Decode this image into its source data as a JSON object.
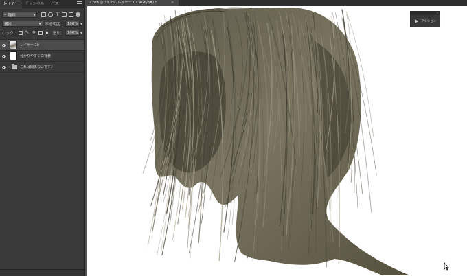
{
  "panel": {
    "tabs": [
      {
        "label": "レイヤー"
      },
      {
        "label": "チャンネル"
      },
      {
        "label": "パス"
      }
    ],
    "filter": {
      "value": "種類"
    },
    "blend_mode": {
      "value": "通常"
    },
    "opacity": {
      "label": "不透明度：",
      "value": "100%"
    },
    "lock": {
      "label": "ロック："
    },
    "fill": {
      "label": "塗り：",
      "value": "100%"
    },
    "layers": [
      {
        "name": "レイヤー 10",
        "selected": true
      },
      {
        "name": "分かりやすく白背景"
      },
      {
        "name": "これは関係ないです♪"
      }
    ]
  },
  "document": {
    "tab_title": "2.psb @ 33.3% (レイヤー 10, RGB/8#) *",
    "close_glyph": "×"
  },
  "actions_panel": {
    "label": "アクション",
    "collapse_glyph": "«",
    "close_glyph": "×"
  },
  "colors": {
    "hair_base": "#6e6a58",
    "hair_dark": "#3e3b2f",
    "hair_light": "#a8a38c",
    "canvas_bg": "#ffffff",
    "panel_bg": "#393939"
  }
}
